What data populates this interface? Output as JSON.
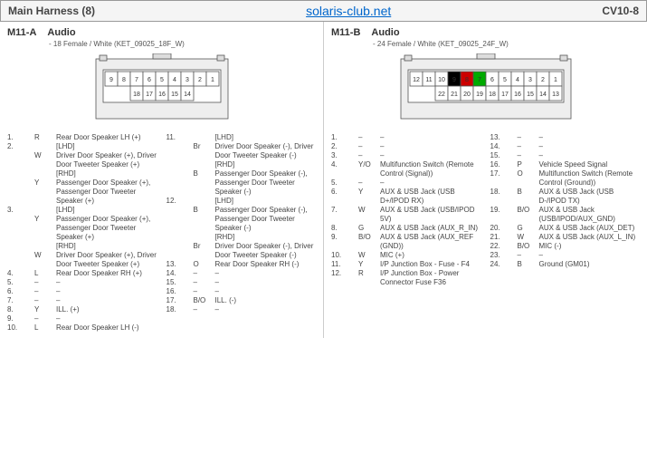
{
  "header": {
    "left": "Main Harness (8)",
    "mid": "solaris-club.net",
    "right": "CV10-8"
  },
  "left": {
    "id": "M11-A",
    "title": "Audio",
    "sub": "- 18 Female / White (KET_09025_18F_W)",
    "topRow": [
      "9",
      "8",
      "7",
      "6",
      "5",
      "4",
      "3",
      "2",
      "1"
    ],
    "botRow": [
      "18",
      "17",
      "16",
      "15",
      "14"
    ],
    "pinsA": [
      {
        "n": "1.",
        "c": "R",
        "d": "Rear Door Speaker LH (+)"
      },
      {
        "n": "2.",
        "c": "",
        "d": "[LHD]"
      },
      {
        "n": "",
        "c": "W",
        "d": "Driver Door Speaker (+), Driver Door Tweeter Speaker (+)"
      },
      {
        "n": "",
        "c": "",
        "d": "[RHD]"
      },
      {
        "n": "",
        "c": "Y",
        "d": "Passenger Door Speaker (+), Passenger Door Tweeter Speaker (+)"
      },
      {
        "n": "3.",
        "c": "",
        "d": "[LHD]"
      },
      {
        "n": "",
        "c": "Y",
        "d": "Passenger Door Speaker (+), Passenger Door Tweeter Speaker (+)"
      },
      {
        "n": "",
        "c": "",
        "d": "[RHD]"
      },
      {
        "n": "",
        "c": "W",
        "d": "Driver Door Speaker (+), Driver Door Tweeter Speaker (+)"
      },
      {
        "n": "4.",
        "c": "L",
        "d": "Rear Door Speaker RH (+)"
      },
      {
        "n": "5.",
        "c": "–",
        "d": "–"
      },
      {
        "n": "6.",
        "c": "–",
        "d": "–"
      },
      {
        "n": "7.",
        "c": "–",
        "d": "–"
      },
      {
        "n": "8.",
        "c": "Y",
        "d": "ILL. (+)"
      },
      {
        "n": "9.",
        "c": "–",
        "d": "–"
      },
      {
        "n": "10.",
        "c": "L",
        "d": "Rear Door Speaker LH (-)"
      }
    ],
    "pinsB": [
      {
        "n": "11.",
        "c": "",
        "d": "[LHD]"
      },
      {
        "n": "",
        "c": "Br",
        "d": "Driver Door Speaker (-), Driver Door Tweeter Speaker (-)"
      },
      {
        "n": "",
        "c": "",
        "d": "[RHD]"
      },
      {
        "n": "",
        "c": "B",
        "d": "Passenger Door Speaker (-), Passenger Door Tweeter Speaker (-)"
      },
      {
        "n": "12.",
        "c": "",
        "d": "[LHD]"
      },
      {
        "n": "",
        "c": "B",
        "d": "Passenger Door Speaker (-), Passenger Door Tweeter Speaker (-)"
      },
      {
        "n": "",
        "c": "",
        "d": "[RHD]"
      },
      {
        "n": "",
        "c": "Br",
        "d": "Driver Door Speaker (-), Driver Door Tweeter Speaker (-)"
      },
      {
        "n": "13.",
        "c": "O",
        "d": "Rear Door Speaker RH (-)"
      },
      {
        "n": "14.",
        "c": "–",
        "d": "–"
      },
      {
        "n": "15.",
        "c": "–",
        "d": "–"
      },
      {
        "n": "16.",
        "c": "–",
        "d": "–"
      },
      {
        "n": "17.",
        "c": "B/O",
        "d": "ILL. (-)"
      },
      {
        "n": "18.",
        "c": "–",
        "d": "–"
      }
    ]
  },
  "right": {
    "id": "M11-B",
    "title": "Audio",
    "sub": "- 24 Female / White (KET_09025_24F_W)",
    "topRow": [
      "12",
      "11",
      "10",
      "9",
      "8",
      "7",
      "6",
      "5",
      "4",
      "3",
      "2",
      "1"
    ],
    "botRow": [
      "22",
      "21",
      "20",
      "19",
      "18",
      "17",
      "16",
      "15",
      "14",
      "13"
    ],
    "colorPins": {
      "9": "#000",
      "8": "#c00",
      "7": "#0a0"
    },
    "pinsA": [
      {
        "n": "1.",
        "c": "–",
        "d": "–"
      },
      {
        "n": "2.",
        "c": "–",
        "d": "–"
      },
      {
        "n": "3.",
        "c": "–",
        "d": "–"
      },
      {
        "n": "4.",
        "c": "Y/O",
        "d": "Multifunction Switch (Remote Control (Signal))"
      },
      {
        "n": "5.",
        "c": "–",
        "d": "–"
      },
      {
        "n": "6.",
        "c": "Y",
        "d": "AUX & USB Jack (USB D+/IPOD RX)"
      },
      {
        "n": "7.",
        "c": "W",
        "d": "AUX & USB Jack (USB/IPOD 5V)"
      },
      {
        "n": "8.",
        "c": "G",
        "d": "AUX & USB Jack (AUX_R_IN)"
      },
      {
        "n": "9.",
        "c": "B/O",
        "d": "AUX & USB Jack (AUX_REF (GND))"
      },
      {
        "n": "10.",
        "c": "W",
        "d": "MIC (+)"
      },
      {
        "n": "11.",
        "c": "Y",
        "d": "I/P Junction Box - Fuse - F4"
      },
      {
        "n": "12.",
        "c": "R",
        "d": "I/P Junction Box - Power Connector Fuse F36"
      }
    ],
    "pinsB": [
      {
        "n": "13.",
        "c": "–",
        "d": "–"
      },
      {
        "n": "14.",
        "c": "–",
        "d": "–"
      },
      {
        "n": "15.",
        "c": "–",
        "d": "–"
      },
      {
        "n": "16.",
        "c": "P",
        "d": "Vehicle Speed Signal"
      },
      {
        "n": "17.",
        "c": "O",
        "d": "Multifunction Switch (Remote Control (Ground))"
      },
      {
        "n": "18.",
        "c": "B",
        "d": "AUX & USB Jack (USB D-/IPOD TX)"
      },
      {
        "n": "19.",
        "c": "B/O",
        "d": "AUX & USB Jack (USB/IPOD/AUX_GND)"
      },
      {
        "n": "20.",
        "c": "G",
        "d": "AUX & USB Jack (AUX_DET)"
      },
      {
        "n": "21.",
        "c": "W",
        "d": "AUX & USB Jack (AUX_L_IN)"
      },
      {
        "n": "22.",
        "c": "B/O",
        "d": "MIC (-)"
      },
      {
        "n": "23.",
        "c": "–",
        "d": "–"
      },
      {
        "n": "24.",
        "c": "B",
        "d": "Ground (GM01)"
      }
    ]
  }
}
